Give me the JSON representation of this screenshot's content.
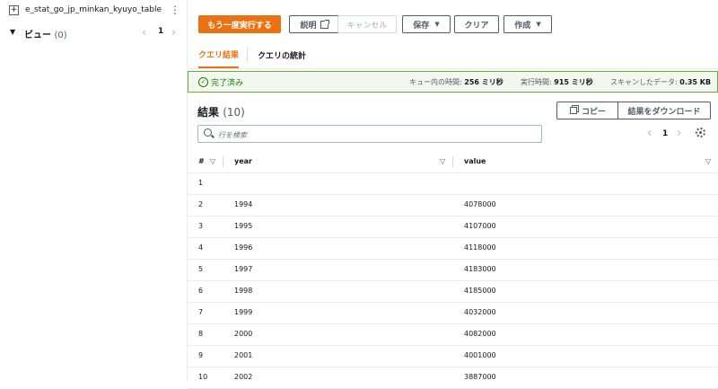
{
  "sidebar": {
    "table_name": "e_stat_go_jp_minkan_kyuyo_table",
    "views_label": "ビュー",
    "views_count": "(0)",
    "page": "1"
  },
  "toolbar": {
    "rerun": "もう一度実行する",
    "explain": "説明",
    "cancel": "キャンセル",
    "save": "保存",
    "clear": "クリア",
    "create": "作成"
  },
  "tabs": [
    {
      "label": "クエリ結果",
      "active": true
    },
    {
      "label": "クエリの統計",
      "active": false
    }
  ],
  "status": {
    "state": "完了済み",
    "queue_label": "キュー内の時間:",
    "queue_value": "256 ミリ秒",
    "exec_label": "実行時間:",
    "exec_value": "915 ミリ秒",
    "scan_label": "スキャンしたデータ:",
    "scan_value": "0.35 KB"
  },
  "results": {
    "title": "結果",
    "count": "(10)",
    "copy_label": "コピー",
    "download_label": "結果をダウンロード",
    "search_placeholder": "行を検索",
    "page": "1",
    "columns": [
      "#",
      "year",
      "value"
    ],
    "rows": [
      {
        "n": "1",
        "year": "",
        "value": ""
      },
      {
        "n": "2",
        "year": "1994",
        "value": "4078000"
      },
      {
        "n": "3",
        "year": "1995",
        "value": "4107000"
      },
      {
        "n": "4",
        "year": "1996",
        "value": "4118000"
      },
      {
        "n": "5",
        "year": "1997",
        "value": "4183000"
      },
      {
        "n": "6",
        "year": "1998",
        "value": "4185000"
      },
      {
        "n": "7",
        "year": "1999",
        "value": "4032000"
      },
      {
        "n": "8",
        "year": "2000",
        "value": "4082000"
      },
      {
        "n": "9",
        "year": "2001",
        "value": "4001000"
      },
      {
        "n": "10",
        "year": "2002",
        "value": "3887000"
      }
    ]
  },
  "colors": {
    "accent": "#ec7211",
    "success": "#1d8102"
  }
}
